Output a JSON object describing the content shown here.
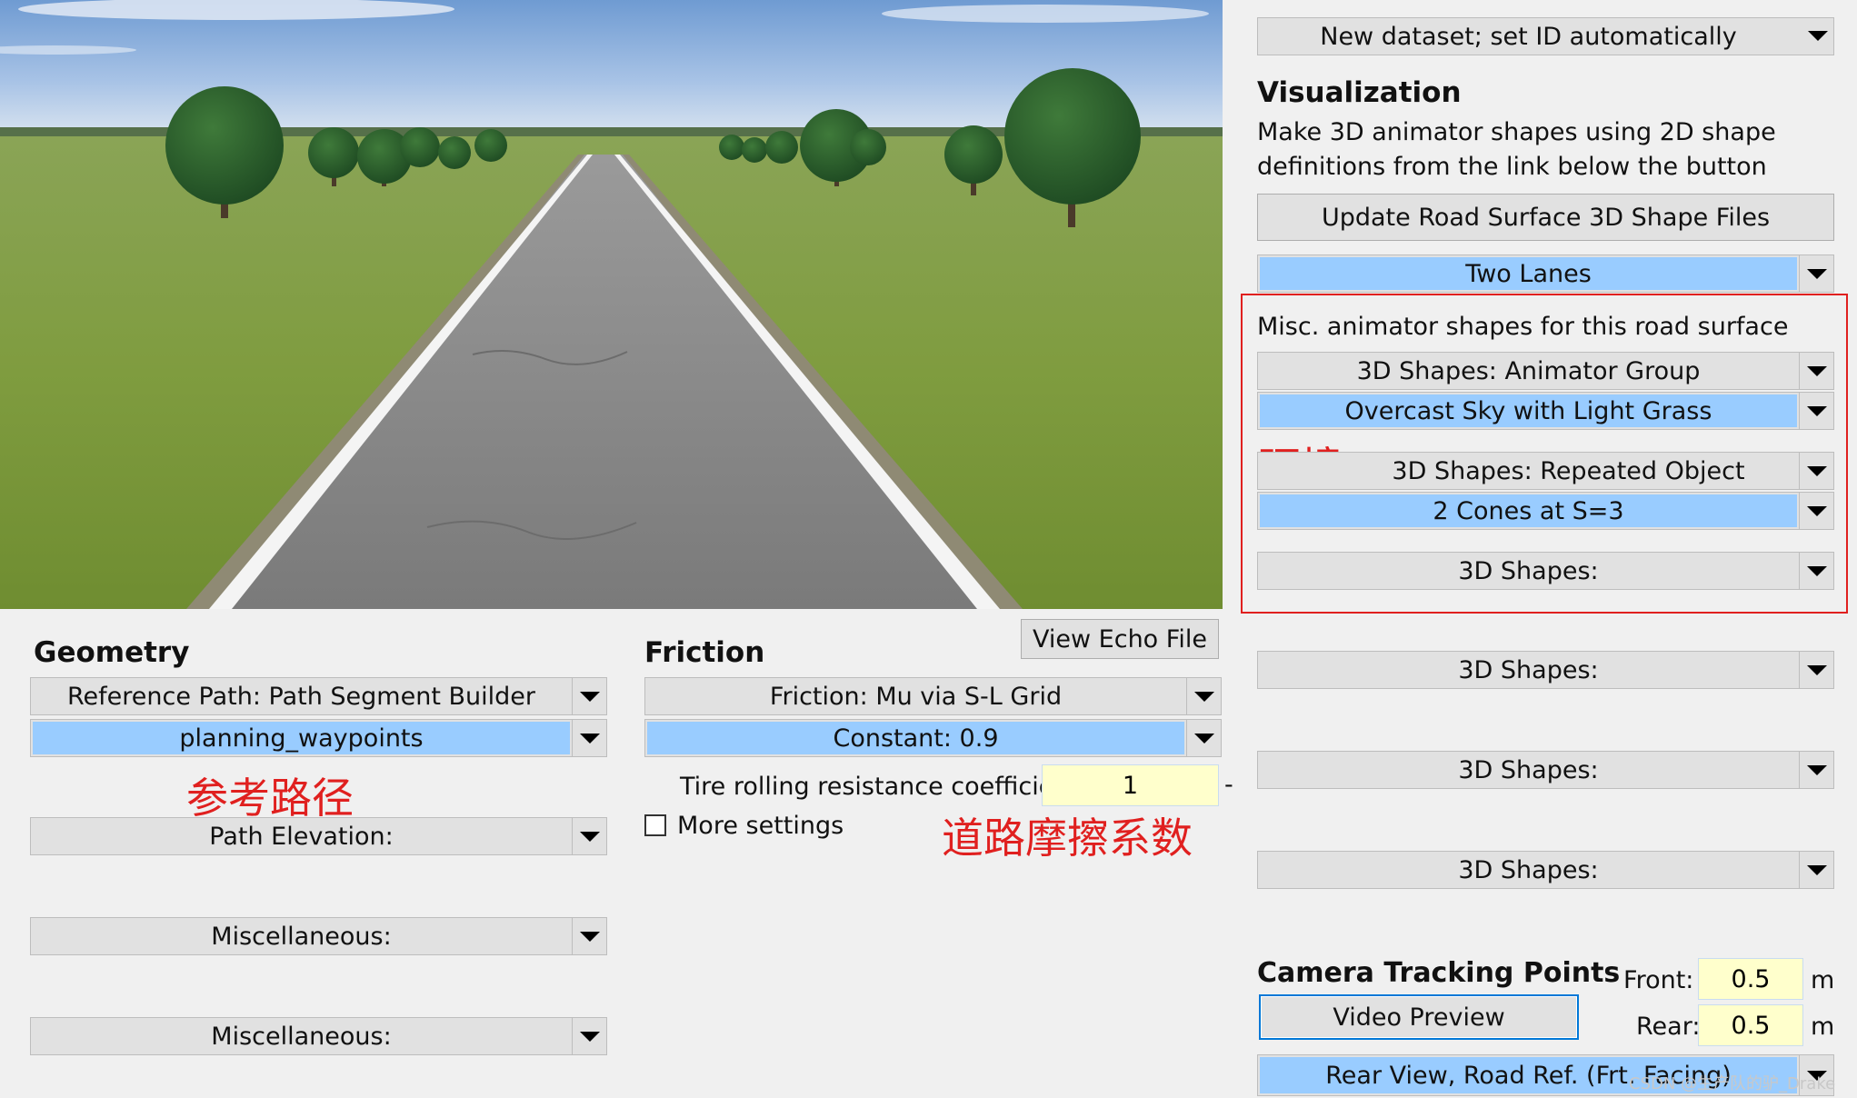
{
  "dataset_select": {
    "value": "New dataset; set ID automatically"
  },
  "visualization": {
    "heading": "Visualization",
    "description_line1": "Make 3D animator shapes using 2D shape",
    "description_line2": "definitions from the link below the button",
    "update_button": "Update Road Surface 3D Shape Files",
    "road_surface": "Two Lanes",
    "misc_label": "Misc. animator shapes for this road surface",
    "animator_group": "3D Shapes: Animator Group",
    "sky_grass": "Overcast Sky with Light Grass",
    "repeated_object": "3D Shapes: Repeated Object",
    "cones": "2 Cones at S=3",
    "shapes_1": "3D Shapes:",
    "shapes_2": "3D Shapes:",
    "shapes_3": "3D Shapes:",
    "shapes_4": "3D Shapes:"
  },
  "annotations": {
    "environment": "环境",
    "reference_path": "参考路径",
    "road_friction": "道路摩擦系数"
  },
  "view_echo_button": "View Echo File",
  "geometry": {
    "heading": "Geometry",
    "reference_path": "Reference Path: Path Segment Builder",
    "waypoints": "planning_waypoints",
    "path_elevation": "Path Elevation:",
    "misc_1": "Miscellaneous:",
    "misc_2": "Miscellaneous:"
  },
  "friction": {
    "heading": "Friction",
    "mode": "Friction: Mu via S-L Grid",
    "constant": "Constant: 0.9",
    "tire_label": "Tire rolling resistance coefficient:",
    "tire_value": "1",
    "tire_unit": "-",
    "more_settings": "More settings"
  },
  "camera": {
    "heading": "Camera Tracking Points",
    "video_preview": "Video Preview",
    "front_label": "Front:",
    "front_value": "0.5",
    "front_unit": "m",
    "rear_label": "Rear:",
    "rear_value": "0.5",
    "rear_unit": "m",
    "view_select": "Rear View, Road Ref. (Frt. Facing)"
  },
  "watermark": "CSDN @生产队的驴_Drake",
  "colors": {
    "selected_field": "#99ccff",
    "input_bg": "#ffffcc",
    "annotation_red": "#e0201f"
  }
}
